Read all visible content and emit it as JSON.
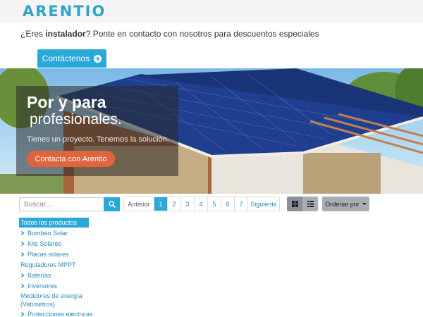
{
  "header": {
    "logo_text": "ARENTIO"
  },
  "promo": {
    "prefix": "¿Eres ",
    "bold": "instalador",
    "suffix": "? Ponte en contacto con nosotros para descuentos especiales"
  },
  "contact_button": {
    "label": "Contáctenos",
    "icon": "circle-arrow-right-icon"
  },
  "hero": {
    "title_line1": "Por y para",
    "title_line2": "profesionales.",
    "subtitle": "Tienes un proyecto. Tenemos la solución.",
    "cta_label": "Contacta con Arentio"
  },
  "search": {
    "placeholder": "Buscar...",
    "icon": "search-icon"
  },
  "pagination": {
    "prev": "Anterior",
    "pages": [
      "1",
      "2",
      "3",
      "4",
      "5",
      "6",
      "7"
    ],
    "active": "1",
    "next": "Siguiente"
  },
  "view": {
    "grid_icon": "grid-view-icon",
    "list_icon": "list-view-icon"
  },
  "sort": {
    "label": "Ordenar por"
  },
  "categories": [
    {
      "label": "Todos los productos",
      "active": true,
      "expandable": false
    },
    {
      "label": "Bombeo Solar",
      "active": false,
      "expandable": true
    },
    {
      "label": "Kits Solares",
      "active": false,
      "expandable": true
    },
    {
      "label": "Placas solares",
      "active": false,
      "expandable": true
    },
    {
      "label": "Reguladores MPPT",
      "active": false,
      "expandable": false
    },
    {
      "label": "Baterías",
      "active": false,
      "expandable": true
    },
    {
      "label": "Inversores",
      "active": false,
      "expandable": true
    },
    {
      "label": "Medidores de energía (Vatímetros)",
      "active": false,
      "expandable": false
    },
    {
      "label": "Protecciones eléctricas",
      "active": false,
      "expandable": true
    }
  ],
  "colors": {
    "accent": "#29a8d9",
    "cta": "#e0643d",
    "logo": "#2fa4c9"
  }
}
